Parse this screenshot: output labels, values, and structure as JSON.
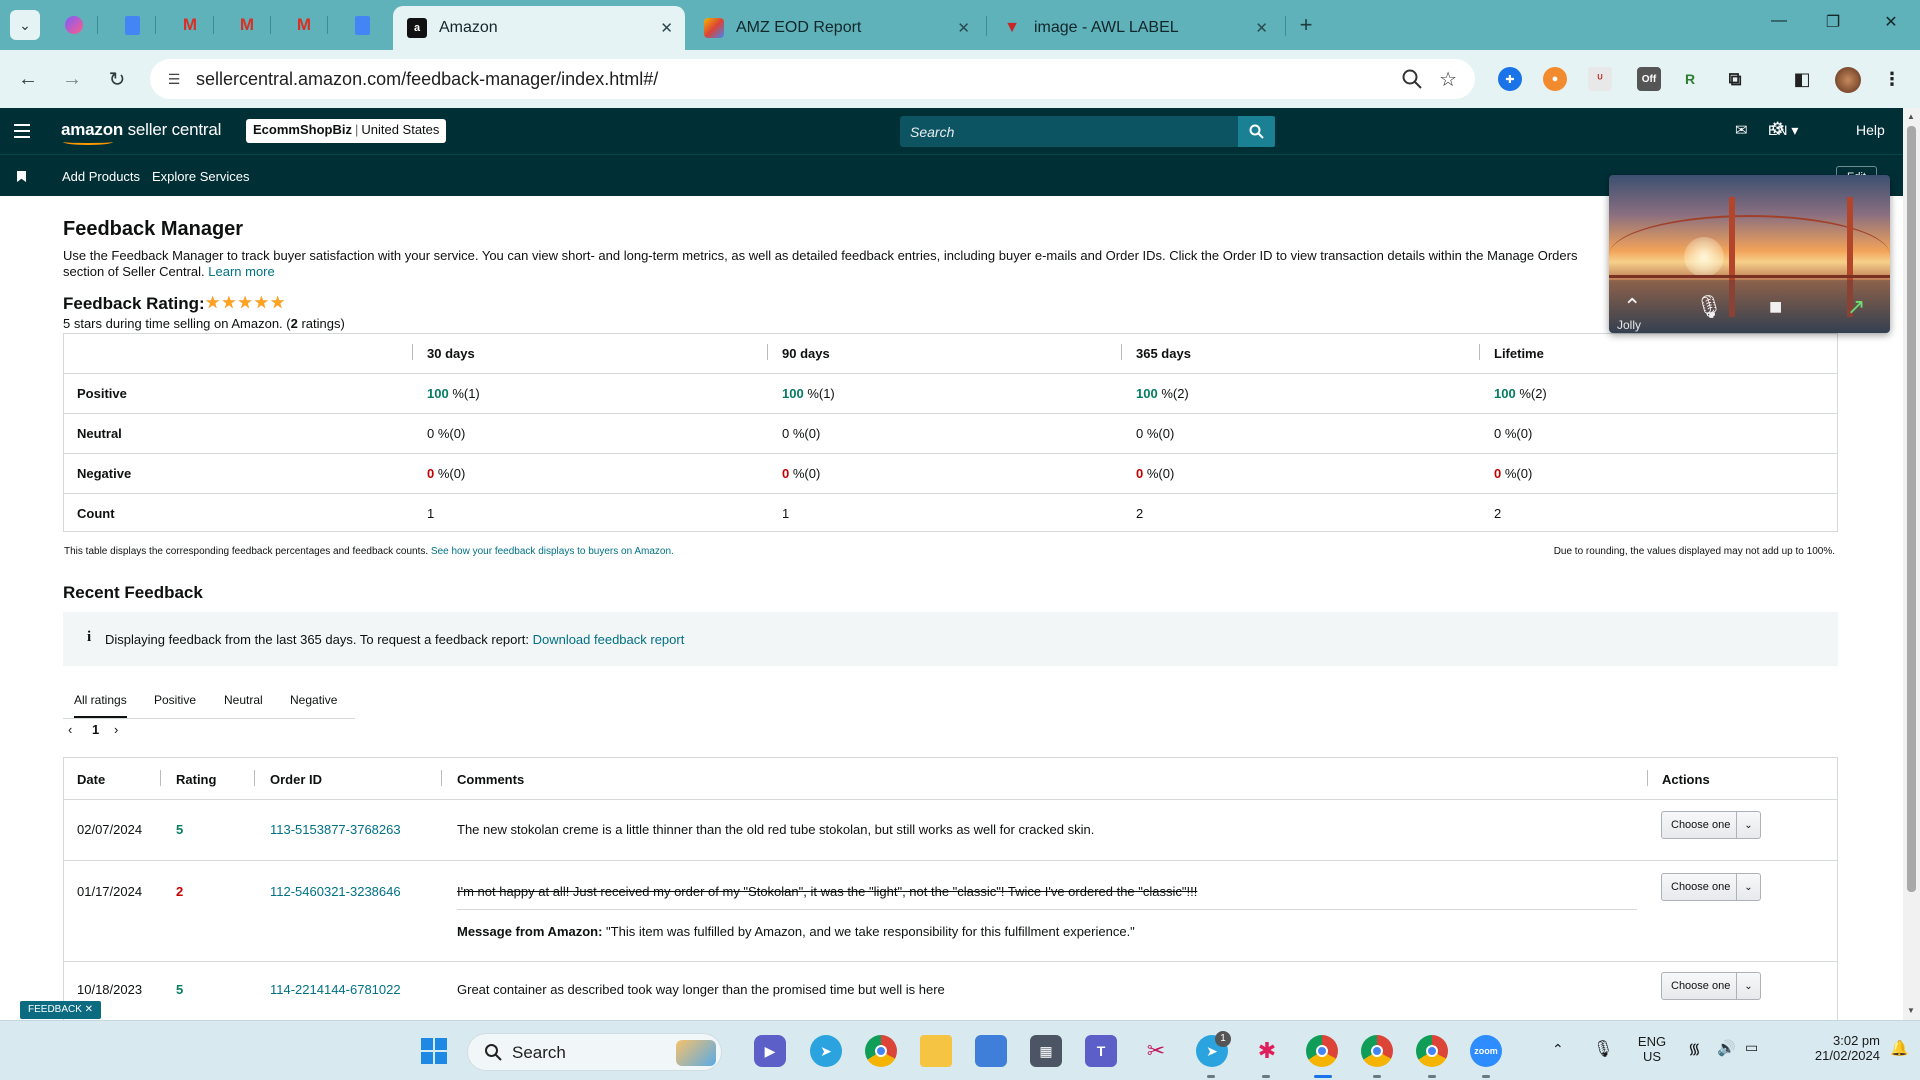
{
  "browser": {
    "tabs": [
      {
        "title": "Amazon",
        "active": true
      },
      {
        "title": "AMZ EOD Report",
        "active": false
      },
      {
        "title": "image - AWL LABEL",
        "active": false
      }
    ],
    "url": "sellercentral.amazon.com/feedback-manager/index.html#/",
    "extension_badge": "Off"
  },
  "header": {
    "logo_brand": "amazon",
    "logo_rest": " seller central",
    "store_name": "EcommShopBiz",
    "store_country": "United States",
    "search_placeholder": "Search",
    "language": "EN ▾",
    "help": "Help"
  },
  "subnav": {
    "items": [
      "Add Products",
      "Explore Services"
    ],
    "edit": "Edit"
  },
  "page": {
    "title": "Feedback Manager",
    "description": "Use the Feedback Manager to track buyer satisfaction with your service. You can view short- and long-term metrics, as well as detailed feedback entries, including buyer e-mails and Order IDs. Click the Order ID to view transaction details within the Manage Orders section of Seller Central.",
    "learn_more": "Learn more",
    "rating_label": "Feedback Rating:",
    "stars_display": "★★★★★",
    "rating_stars": 5,
    "rating_sub_prefix": "5 stars during time selling on Amazon. (",
    "rating_count": "2",
    "rating_sub_suffix": " ratings)"
  },
  "metrics": {
    "columns": [
      "30 days",
      "90 days",
      "365 days",
      "Lifetime"
    ],
    "rows": [
      {
        "label": "Positive",
        "cells": [
          [
            "100",
            " %(1)"
          ],
          [
            "100",
            " %(1)"
          ],
          [
            "100",
            " %(2)"
          ],
          [
            "100",
            " %(2)"
          ]
        ]
      },
      {
        "label": "Neutral",
        "cells": [
          [
            "0",
            " %(0)"
          ],
          [
            "0",
            " %(0)"
          ],
          [
            "0",
            " %(0)"
          ],
          [
            "0",
            " %(0)"
          ]
        ]
      },
      {
        "label": "Negative",
        "cells": [
          [
            "0",
            " %(0)"
          ],
          [
            "0",
            " %(0)"
          ],
          [
            "0",
            " %(0)"
          ],
          [
            "0",
            " %(0)"
          ]
        ]
      },
      {
        "label": "Count",
        "cells": [
          [
            "1",
            ""
          ],
          [
            "1",
            ""
          ],
          [
            "2",
            ""
          ],
          [
            "2",
            ""
          ]
        ]
      }
    ],
    "footnote_left": "This table displays the corresponding feedback percentages and feedback counts.",
    "footnote_link": "See how your feedback displays to buyers on Amazon.",
    "footnote_right": "Due to rounding, the values displayed may not add up to 100%."
  },
  "recent": {
    "title": "Recent Feedback",
    "info_text": "Displaying feedback from the last 365 days. To request a feedback report:",
    "info_link": "Download feedback report",
    "filter_tabs": [
      "All ratings",
      "Positive",
      "Neutral",
      "Negative"
    ],
    "page_number": "1",
    "columns": [
      "Date",
      "Rating",
      "Order ID",
      "Comments",
      "Actions"
    ],
    "rows": [
      {
        "date": "02/07/2024",
        "rating": "5",
        "order_id": "113-5153877-3768263",
        "comment": "The new stokolan creme is a little thinner than the old red tube stokolan, but still works as well for cracked skin.",
        "action": "Choose one"
      },
      {
        "date": "01/17/2024",
        "rating": "2",
        "order_id": "112-5460321-3238646",
        "comment": "I'm not happy at all! Just received my order of my \"Stokolan\", it was the \"light\", not the \"classic\"! Twice I've ordered the \"classic\"!!!",
        "message_label": "Message from Amazon:",
        "message": " \"This item was fulfilled by Amazon, and we take responsibility for this fulfillment experience.\"",
        "action": "Choose one"
      },
      {
        "date": "10/18/2023",
        "rating": "5",
        "order_id": "114-2214144-6781022",
        "comment": "Great container as described took way longer than the promised time but well is here",
        "action": "Choose one"
      }
    ]
  },
  "feedback_tag": "FEEDBACK ✕",
  "video": {
    "name": "Jolly"
  },
  "taskbar": {
    "search": "Search",
    "lang_top": "ENG",
    "lang_bottom": "US",
    "time": "3:02 pm",
    "date": "21/02/2024",
    "telegram_badge": "1"
  },
  "colors": {
    "header_bg": "#002f36",
    "link": "#007185",
    "positive": "#067d62",
    "negative": "#c40000",
    "tabbar": "#5fb2b9"
  }
}
